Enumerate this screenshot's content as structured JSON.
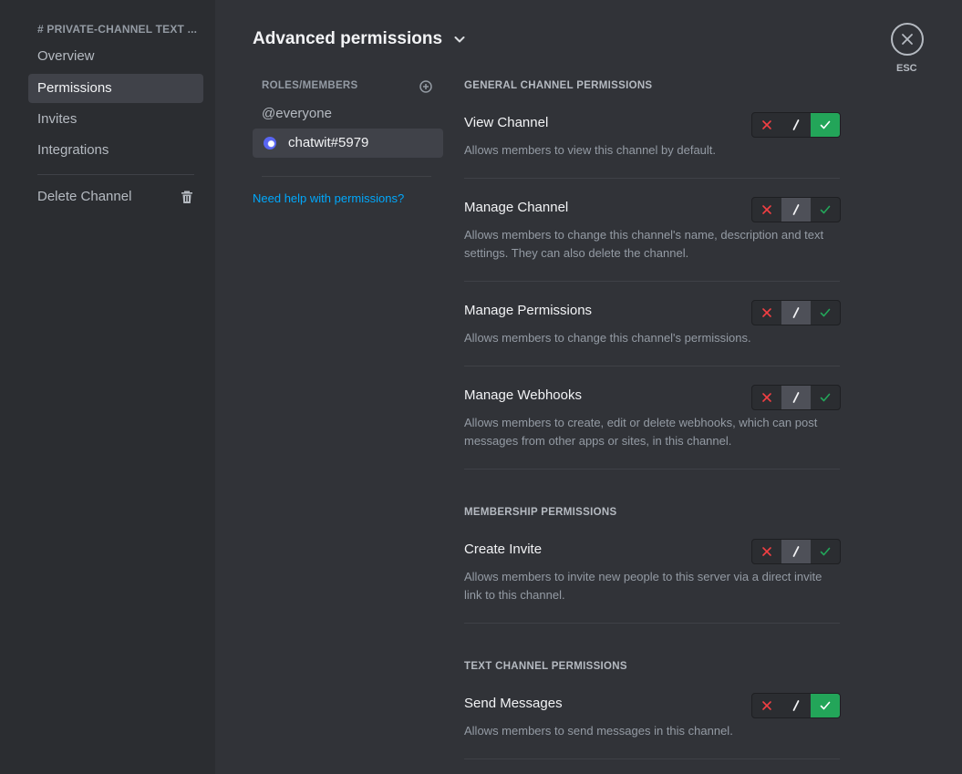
{
  "sidebar": {
    "header": "# PRIVATE-CHANNEL TEXT ...",
    "items": [
      {
        "label": "Overview"
      },
      {
        "label": "Permissions"
      },
      {
        "label": "Invites"
      },
      {
        "label": "Integrations"
      }
    ],
    "delete_label": "Delete Channel"
  },
  "main": {
    "title": "Advanced permissions",
    "roles_header": "ROLES/MEMBERS",
    "roles": [
      {
        "label": "@everyone"
      },
      {
        "label": "chatwit#5979"
      }
    ],
    "help_link": "Need help with permissions?"
  },
  "sections": [
    {
      "header": "GENERAL CHANNEL PERMISSIONS",
      "perms": [
        {
          "title": "View Channel",
          "desc": "Allows members to view this channel by default.",
          "state": "allow"
        },
        {
          "title": "Manage Channel",
          "desc": "Allows members to change this channel's name, description and text settings. They can also delete the channel.",
          "state": "neutral"
        },
        {
          "title": "Manage Permissions",
          "desc": "Allows members to change this channel's permissions.",
          "state": "neutral"
        },
        {
          "title": "Manage Webhooks",
          "desc": "Allows members to create, edit or delete webhooks, which can post messages from other apps or sites, in this channel.",
          "state": "neutral"
        }
      ]
    },
    {
      "header": "MEMBERSHIP PERMISSIONS",
      "perms": [
        {
          "title": "Create Invite",
          "desc": "Allows members to invite new people to this server via a direct invite link to this channel.",
          "state": "neutral"
        }
      ]
    },
    {
      "header": "TEXT CHANNEL PERMISSIONS",
      "perms": [
        {
          "title": "Send Messages",
          "desc": "Allows members to send messages in this channel.",
          "state": "allow"
        }
      ]
    }
  ],
  "close": {
    "label": "ESC"
  },
  "colors": {
    "allow": "#23a559",
    "deny": "#f23f43",
    "neutral_active": "#4e5058",
    "link": "#00a8fc"
  },
  "icons": {
    "trash": "trash-icon",
    "chevron": "chevron-down-icon",
    "add": "add-circle-icon",
    "close": "close-icon",
    "deny": "x-icon",
    "neutral": "slash-icon",
    "allow": "check-icon"
  }
}
